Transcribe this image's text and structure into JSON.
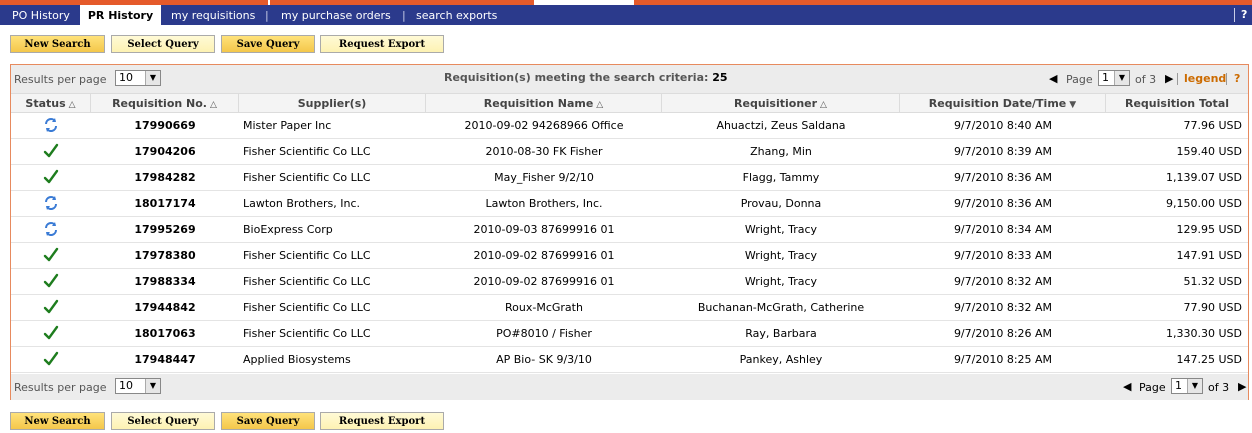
{
  "nav": {
    "tabs": [
      {
        "label": "PO History"
      },
      {
        "label": "PR History"
      },
      {
        "label": "my requisitions"
      },
      {
        "label": "my purchase orders"
      },
      {
        "label": "search exports"
      }
    ],
    "separator": "|",
    "help": "?"
  },
  "actions": {
    "new_search": "New Search",
    "select_query": "Select Query",
    "save_query": "Save Query",
    "request_export": "Request Export"
  },
  "results": {
    "per_page_label": "Results per page",
    "per_page_value": "10",
    "criteria_label": "Requisition(s) meeting the search criteria:",
    "count": "25",
    "page_label": "Page",
    "page_value": "1",
    "of_label": "of 3",
    "legend": "legend",
    "help": "?"
  },
  "columns": {
    "status": "Status",
    "req_no": "Requisition No.",
    "supplier": "Supplier(s)",
    "req_name": "Requisition Name",
    "requisitioner": "Requisitioner",
    "date": "Requisition Date/Time",
    "total": "Requisition Total"
  },
  "rows": [
    {
      "status": "pending-icon",
      "req_no": "17990669",
      "supplier": "Mister Paper Inc",
      "name": "2010-09-02 94268966 Office",
      "requisitioner": "Ahuactzi, Zeus Saldana",
      "date": "9/7/2010 8:40 AM",
      "total": "77.96 USD"
    },
    {
      "status": "check-icon",
      "req_no": "17904206",
      "supplier": "Fisher Scientific Co LLC",
      "name": "2010-08-30 FK Fisher",
      "requisitioner": "Zhang, Min",
      "date": "9/7/2010 8:39 AM",
      "total": "159.40 USD"
    },
    {
      "status": "check-icon",
      "req_no": "17984282",
      "supplier": "Fisher Scientific Co LLC",
      "name": "May_Fisher 9/2/10",
      "requisitioner": "Flagg, Tammy",
      "date": "9/7/2010 8:36 AM",
      "total": "1,139.07 USD"
    },
    {
      "status": "pending-icon",
      "req_no": "18017174",
      "supplier": "Lawton Brothers, Inc.",
      "name": "Lawton Brothers, Inc.",
      "requisitioner": "Provau, Donna",
      "date": "9/7/2010 8:36 AM",
      "total": "9,150.00 USD"
    },
    {
      "status": "pending-icon",
      "req_no": "17995269",
      "supplier": "BioExpress Corp",
      "name": "2010-09-03 87699916 01",
      "requisitioner": "Wright, Tracy",
      "date": "9/7/2010 8:34 AM",
      "total": "129.95 USD"
    },
    {
      "status": "check-icon",
      "req_no": "17978380",
      "supplier": "Fisher Scientific Co LLC",
      "name": "2010-09-02 87699916 01",
      "requisitioner": "Wright, Tracy",
      "date": "9/7/2010 8:33 AM",
      "total": "147.91 USD"
    },
    {
      "status": "check-icon",
      "req_no": "17988334",
      "supplier": "Fisher Scientific Co LLC",
      "name": "2010-09-02 87699916 01",
      "requisitioner": "Wright, Tracy",
      "date": "9/7/2010 8:32 AM",
      "total": "51.32 USD"
    },
    {
      "status": "check-icon",
      "req_no": "17944842",
      "supplier": "Fisher Scientific Co LLC",
      "name": "Roux-McGrath",
      "requisitioner": "Buchanan-McGrath, Catherine",
      "date": "9/7/2010 8:32 AM",
      "total": "77.90 USD"
    },
    {
      "status": "check-icon",
      "req_no": "18017063",
      "supplier": "Fisher Scientific Co LLC",
      "name": "PO#8010 / Fisher",
      "requisitioner": "Ray, Barbara",
      "date": "9/7/2010 8:26 AM",
      "total": "1,330.30 USD"
    },
    {
      "status": "check-icon",
      "req_no": "17948447",
      "supplier": "Applied Biosystems",
      "name": "AP Bio- SK 9/3/10",
      "requisitioner": "Pankey, Ashley",
      "date": "9/7/2010 8:25 AM",
      "total": "147.25 USD"
    }
  ],
  "colors": {
    "nav_bg": "#2b3a8c",
    "accent_orange": "#e55a2b",
    "check_green": "#1e7d1e",
    "pending_blue": "#3a7bd5",
    "legend_orange": "#cc6b00"
  }
}
